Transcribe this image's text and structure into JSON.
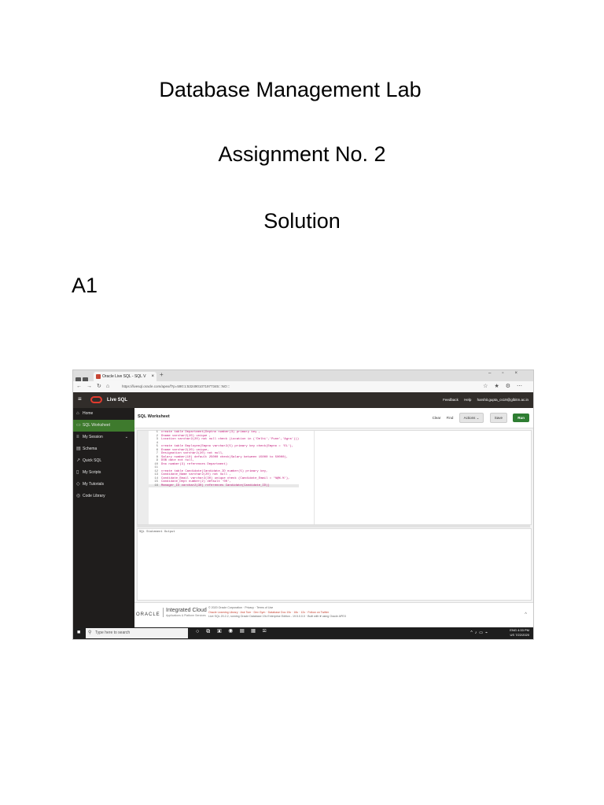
{
  "document": {
    "title": "Database Management Lab",
    "assignment": "Assignment No. 2",
    "solution": "Solution",
    "section": "A1"
  },
  "screenshot": {
    "browser": {
      "tab_title": "Oracle Live SQL - SQL V",
      "tab_close": "×",
      "new_tab": "+",
      "url": "https://livesql.oracle.com/apex/f?p=590:1:5324901071977345:::NO:::"
    },
    "app": {
      "name": "Live SQL",
      "feedback": "Feedback",
      "help": "Help",
      "user": "harshit.gupta_cs19@glbitm.ac.in"
    },
    "sidebar": {
      "items": [
        {
          "label": "Home",
          "icon": "⌂"
        },
        {
          "label": "SQL Worksheet",
          "icon": "▭"
        },
        {
          "label": "My Session",
          "icon": "≡"
        },
        {
          "label": "Schema",
          "icon": "▤"
        },
        {
          "label": "Quick SQL",
          "icon": "↗"
        },
        {
          "label": "My Scripts",
          "icon": "▯"
        },
        {
          "label": "My Tutorials",
          "icon": "◇"
        },
        {
          "label": "Code Library",
          "icon": "◎"
        }
      ],
      "chevron": "⌄"
    },
    "worksheet": {
      "title": "SQL Worksheet",
      "clear": "Clear",
      "find": "Find",
      "actions": "Actions ⌄",
      "save": "Save",
      "run": "Run"
    },
    "code_lines": [
      "create table Department(Deptno number(3) primary key ,",
      "Dname varchar2(20) unique ,",
      "Location varchar2(20) not null check (Location in ('Delhi','Pune','Agra')))",
      "",
      "create table Employee(Empno varchar2(5) primary key check(Empno = 'EL'),",
      "Ename varchar2(20) unique,",
      "Designation varchar2(20) not null,",
      "Salary number(10) default 25000 check(Salary between 15000 to 50000),",
      "DOB date not null,",
      "Dno number(3) references Department)",
      "",
      "create table Candidate(Candidate_ID number(5) primary key,",
      "Candidate_Name varchar2(20) not null ,",
      "Candidate_Email varchar2(30) unique check (Candidate_Email = '%@%.%'),",
      "Candidate_Dept number(2) default '00',",
      "Manager_ID varchar2(30) references Candidate(Candidate_ID))"
    ],
    "output_label": "SQL Statement Output",
    "footer": {
      "oracle": "ORACLE",
      "cloud": "Integrated Cloud",
      "cloud_sub": "Applications & Platform Services",
      "line1": "© 2020 Oracle Corporation · Privacy · Terms of Use",
      "line2": "Oracle Learning Library · Ask Tom · Dev Gym · Database Doc 19c · 18c · 12c · Follow on Twitter",
      "line3": "Live SQL 20.2.2, running Oracle Database 19c Enterprise Edition - 19.5.0.0.0 · Built with ♥ using Oracle APEX"
    },
    "taskbar": {
      "search_placeholder": "Type here to search",
      "lang": "ENG",
      "region": "US",
      "time": "4:33 PM",
      "date": "7/22/2020"
    }
  }
}
